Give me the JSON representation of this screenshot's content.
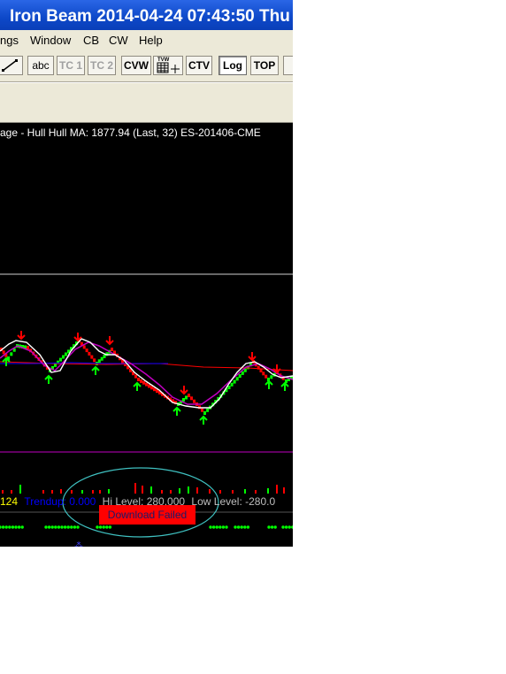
{
  "window": {
    "title": "Iron Beam 2014-04-24  07:43:50 Thu"
  },
  "menu": [
    "ngs",
    "Window",
    "CB",
    "CW",
    "Help"
  ],
  "toolbar": {
    "abc": "abc",
    "tc1": "TC 1",
    "tc2": "TC 2",
    "cvw": "CVW",
    "tvw": "TVW",
    "ctv": "CTV",
    "log": "Log",
    "top": "TOP"
  },
  "chart": {
    "header": "age - Hull  Hull MA: 1877.94    (Last, 32)  ES-201406-CME",
    "indicator": {
      "value": "124",
      "trend_label": "Trendup: 0.000",
      "hi_level": "Hi Level: 280.000",
      "low_level": "Low Level: -280.0"
    },
    "status_popup": "Download Failed"
  },
  "colors": {
    "titlebar": "#0d48c8",
    "bg": "#000000",
    "up": "#00ff00",
    "down": "#ff0000",
    "hull_ma": "#ffffff",
    "slow_ma": "#ff0000",
    "mid_ma": "#0000ff",
    "trend": "#0000ff",
    "popup_ellipse": "#40c0c0"
  }
}
